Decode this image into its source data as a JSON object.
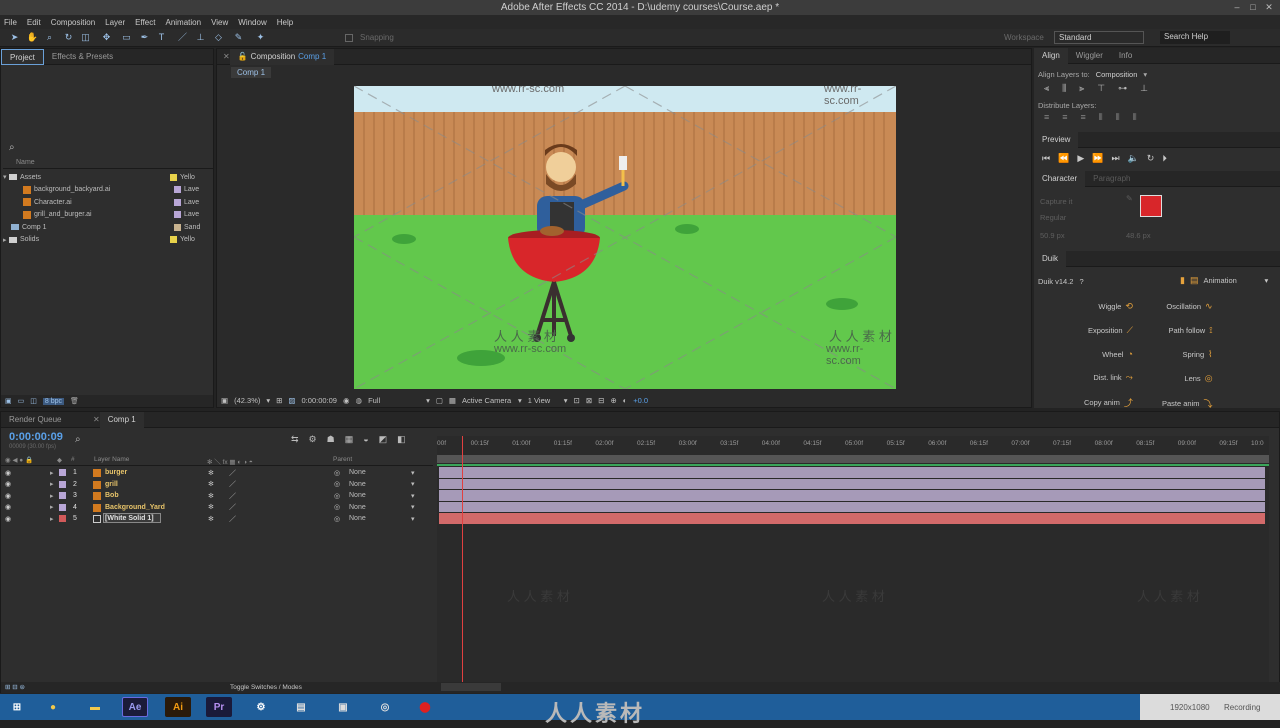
{
  "app": {
    "title": "Adobe After Effects CC 2014 - D:\\udemy courses\\Course.aep *",
    "window_buttons": [
      "–",
      "□",
      "✕"
    ]
  },
  "menu": [
    "File",
    "Edit",
    "Composition",
    "Layer",
    "Effect",
    "Animation",
    "View",
    "Window",
    "Help"
  ],
  "toolbar": {
    "snapping": "Snapping",
    "workspace_label": "Workspace",
    "workspace_value": "Standard",
    "search_help": "Search Help"
  },
  "project_panel": {
    "tabs": [
      "Project",
      "Effects & Presets"
    ],
    "col_name": "Name",
    "items": [
      {
        "name": "Assets",
        "label": "Yello",
        "type": "folder",
        "depth": 0
      },
      {
        "name": "background_backyard.ai",
        "label": "Lave",
        "type": "ai",
        "depth": 1
      },
      {
        "name": "Character.ai",
        "label": "Lave",
        "type": "ai",
        "depth": 1
      },
      {
        "name": "grill_and_burger.ai",
        "label": "Lave",
        "type": "ai",
        "depth": 1
      },
      {
        "name": "Comp 1",
        "label": "Sand",
        "type": "comp",
        "depth": 0
      },
      {
        "name": "Solids",
        "label": "Yello",
        "type": "folder",
        "depth": 0
      }
    ],
    "bpc": "8 bpc"
  },
  "composition_panel": {
    "tab_prefix": "Composition",
    "tab_name": "Comp 1",
    "breadcrumb": "Comp 1",
    "zoom": "(42.3%)",
    "timecode": "0:00:00:09",
    "resolution": "Full",
    "camera": "Active Camera",
    "views": "1 View",
    "exposure": "+0.0",
    "watermark_url": "www.rr-sc.com",
    "watermark_cn": "人 人 素 材"
  },
  "align_panel": {
    "tabs": [
      "Align",
      "Wiggler",
      "Info"
    ],
    "align_to_label": "Align Layers to:",
    "align_to_value": "Composition",
    "distribute_label": "Distribute Layers:"
  },
  "preview_panel": {
    "title": "Preview"
  },
  "character_panel": {
    "tabs": [
      "Character",
      "Paragraph"
    ],
    "font": "Capture it",
    "style": "Regular",
    "size": "50.9 px",
    "leading": "48.6 px",
    "fill_color": "#d8262a"
  },
  "duik_panel": {
    "title": "Duik",
    "version": "Duik v14.2",
    "help": "?",
    "mode": "Animation",
    "buttons_left": [
      "Wiggle",
      "Exposition",
      "Wheel",
      "Dist. link",
      "Copy anim"
    ],
    "buttons_right": [
      "Oscillation",
      "Path follow",
      "Spring",
      "Lens",
      "Paste anim"
    ]
  },
  "timeline_panel": {
    "tabs": [
      "Render Queue",
      "Comp 1"
    ],
    "timecode": "0:00:00:09",
    "frame_info": "00009 (30.00 fps)",
    "col_layer_name": "Layer Name",
    "col_parent": "Parent",
    "layers": [
      {
        "num": "1",
        "name": "burger",
        "parent": "None",
        "label_color": "#b8a6d6",
        "bar_color": "#a69ab8"
      },
      {
        "num": "2",
        "name": "grill",
        "parent": "None",
        "label_color": "#b8a6d6",
        "bar_color": "#a69ab8"
      },
      {
        "num": "3",
        "name": "Bob",
        "parent": "None",
        "label_color": "#b8a6d6",
        "bar_color": "#a69ab8"
      },
      {
        "num": "4",
        "name": "Background_Yard",
        "parent": "None",
        "label_color": "#b8a6d6",
        "bar_color": "#a69ab8"
      },
      {
        "num": "5",
        "name": "[White Solid 1]",
        "parent": "None",
        "label_color": "#d25a5a",
        "bar_color": "#d26a6a"
      }
    ],
    "ruler": [
      "00f",
      "00:15f",
      "01:00f",
      "01:15f",
      "02:00f",
      "02:15f",
      "03:00f",
      "03:15f",
      "04:00f",
      "04:15f",
      "05:00f",
      "05:15f",
      "06:00f",
      "06:15f",
      "07:00f",
      "07:15f",
      "08:00f",
      "08:15f",
      "09:00f",
      "09:15f",
      "10:0"
    ],
    "toggle_label": "Toggle Switches / Modes",
    "playhead_fraction": 0.03
  },
  "taskbar": {
    "items": [
      "Start",
      "Chrome",
      "Explorer",
      "Ae",
      "Ai",
      "Pr",
      "Settings",
      "Docs",
      "Remote",
      "Network",
      "Record"
    ],
    "resolution": "1920x1080",
    "recording": "Recording"
  },
  "watermark_bottom": "人人素材"
}
